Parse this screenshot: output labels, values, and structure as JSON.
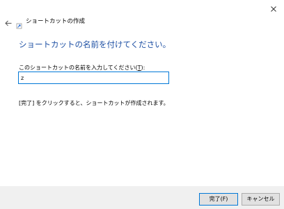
{
  "window": {
    "close_icon": "close-icon"
  },
  "header": {
    "back_icon": "back-arrow-icon",
    "wizard_icon": "shortcut-icon",
    "wizard_title": "ショートカットの作成"
  },
  "main": {
    "heading": "ショートカットの名前を付けてください。",
    "field_label_prefix": "このショートカットの名前を入力してください(",
    "field_label_accel": "T",
    "field_label_suffix": "):",
    "name_value": "z",
    "note": "[完了] をクリックすると、ショートカットが作成されます。"
  },
  "footer": {
    "finish_label": "完了(F)",
    "cancel_label": "キャンセル"
  },
  "colors": {
    "heading": "#1d4fa3",
    "input_border_focus": "#0078d7",
    "footer_bg": "#f0f0f0",
    "button_bg": "#e1e1e1"
  }
}
